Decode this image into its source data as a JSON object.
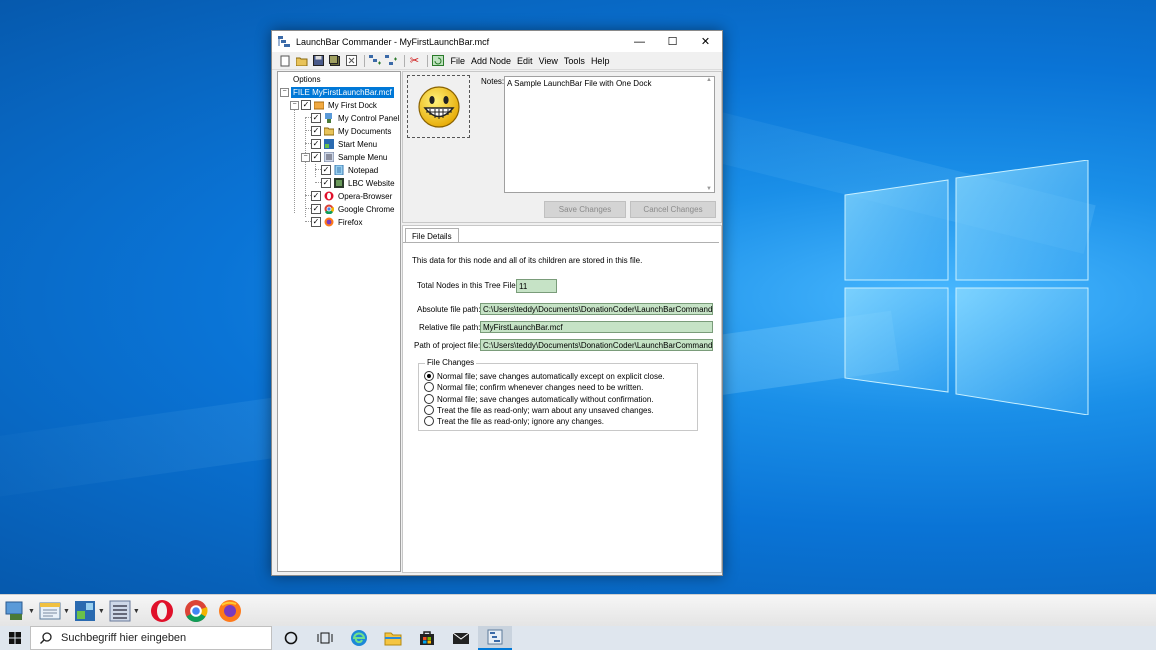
{
  "window": {
    "title": "LaunchBar Commander - MyFirstLaunchBar.mcf",
    "minimize": "—",
    "maximize": "☐",
    "close": "✕"
  },
  "menu": [
    "File",
    "Add Node",
    "Edit",
    "View",
    "Tools",
    "Help"
  ],
  "tree": {
    "options_label": "Options",
    "file_node": "FILE MyFirstLaunchBar.mcf",
    "dock": "My First Dock",
    "items": [
      {
        "label": "My Control Panel",
        "icon": "control-panel-icon"
      },
      {
        "label": "My Documents",
        "icon": "documents-icon"
      },
      {
        "label": "Start Menu",
        "icon": "start-menu-icon"
      },
      {
        "label": "Sample Menu",
        "icon": "menu-icon"
      },
      {
        "label": "Notepad",
        "icon": "notepad-icon"
      },
      {
        "label": "LBC Website",
        "icon": "website-icon"
      },
      {
        "label": "Opera-Browser",
        "icon": "opera-icon"
      },
      {
        "label": "Google Chrome",
        "icon": "chrome-icon"
      },
      {
        "label": "Firefox",
        "icon": "firefox-icon"
      }
    ]
  },
  "details": {
    "notes_label": "Notes:",
    "notes_value": "A Sample LaunchBar File with One Dock",
    "save_changes": "Save Changes",
    "cancel_changes": "Cancel Changes",
    "tab_label": "File Details",
    "info_text": "This data for this node and all of its children are stored in this file.",
    "total_nodes_label": "Total Nodes in this Tree File:",
    "total_nodes_value": "11",
    "absolute_path_label": "Absolute file path:",
    "absolute_path_value": "C:\\Users\\teddy\\Documents\\DonationCoder\\LaunchBarCommander",
    "relative_path_label": "Relative file path:",
    "relative_path_value": "MyFirstLaunchBar.mcf",
    "project_path_label": "Path of project file:",
    "project_path_value": "C:\\Users\\teddy\\Documents\\DonationCoder\\LaunchBarCommander",
    "file_changes_title": "File Changes",
    "radio_options": [
      "Normal file; save changes automatically except on explicit close.",
      "Normal file; confirm whenever changes need to be written.",
      "Normal file; save changes automatically without confirmation.",
      "Treat the file as read-only; warn about any unsaved changes.",
      "Treat the file as read-only; ignore any changes."
    ],
    "radio_selected_index": 0
  },
  "taskbar": {
    "search_placeholder": "Suchbegriff hier eingeben"
  },
  "colors": {
    "accent": "#0078d7",
    "field_green": "#c6e3c6",
    "desktop_blue": "#0a74d6"
  }
}
